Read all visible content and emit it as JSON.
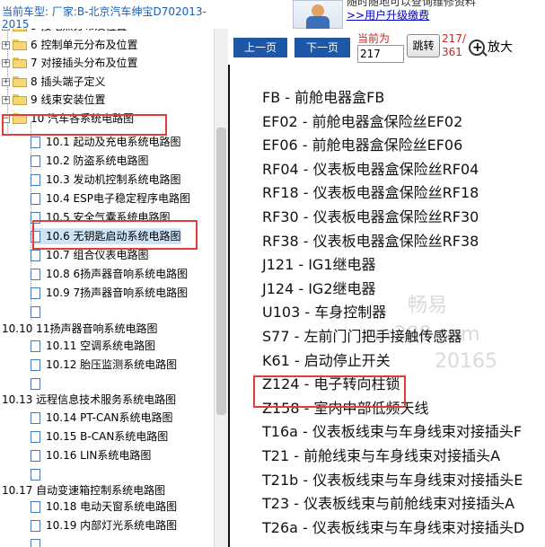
{
  "header": {
    "vehicle_line1": "当前车型: 厂家:B-北京汽车绅宝D702013-",
    "vehicle_line2": "2015",
    "ad_line1": "随时随地可以查询维修资料",
    "ad_link": ">>用户升级缴费"
  },
  "sidebar": {
    "folders_top": [
      {
        "label": "5 接地点分布及位置"
      },
      {
        "label": "6 控制单元分布及位置"
      },
      {
        "label": "7 对接插头分布及位置"
      },
      {
        "label": "8 插头端子定义"
      },
      {
        "label": "9 线束安装位置"
      },
      {
        "label": "10 汽车各系统电路图"
      }
    ],
    "children_a": [
      {
        "label": "10.1 起动及充电系统电路图"
      },
      {
        "label": "10.2 防盗系统电路图"
      },
      {
        "label": "10.3 发动机控制系统电路图"
      },
      {
        "label": "10.4 ESP电子稳定程序电路图"
      },
      {
        "label": "10.5 安全气囊系统电路图"
      },
      {
        "label": "10.6 无钥匙启动系统电路图"
      },
      {
        "label": "10.7 组合仪表电路图"
      },
      {
        "label": "10.8 6扬声器音响系统电路图"
      },
      {
        "label": "10.9 7扬声器音响系统电路图"
      },
      {
        "label": ""
      }
    ],
    "group_1010": "10.10 11扬声器音响系统电路图",
    "children_b": [
      {
        "label": "10.11 空调系统电路图"
      },
      {
        "label": "10.12 胎压监测系统电路图"
      },
      {
        "label": ""
      }
    ],
    "group_1013": "10.13 远程信息技术服务系统电路图",
    "children_c": [
      {
        "label": "10.14 PT-CAN系统电路图"
      },
      {
        "label": "10.15 B-CAN系统电路图"
      },
      {
        "label": "10.16 LIN系统电路图"
      },
      {
        "label": ""
      }
    ],
    "group_1017": "10.17 自动变速箱控制系统电路图",
    "children_d": [
      {
        "label": "10.18 电动天窗系统电路图"
      },
      {
        "label": "10.19 内部灯光系统电路图"
      },
      {
        "label": ""
      }
    ]
  },
  "toolbar": {
    "prev": "上一页",
    "next": "下一页",
    "current_label": "当前为",
    "current_value": "217",
    "jump": "跳转",
    "page_num": "217/",
    "page_total": "361",
    "zoom": "放大"
  },
  "document": {
    "entries": [
      "FB - 前舱电器盒FB",
      "EF02 - 前舱电器盒保险丝EF02",
      "EF06 - 前舱电器盒保险丝EF06",
      "RF04 - 仪表板电器盒保险丝RF04",
      "RF18 - 仪表板电器盒保险丝RF18",
      "RF30 - 仪表板电器盒保险丝RF30",
      "RF38 - 仪表板电器盒保险丝RF38",
      "J121 - IG1继电器",
      "J124 - IG2继电器",
      "U103 - 车身控制器",
      "S77 - 左前门门把手接触传感器",
      "K61 - 启动停止开关",
      "Z124 - 电子转向柱锁",
      "Z158 - 室内中部低频天线",
      "T16a - 仪表板线束与车身线束对接插头F",
      "T21 - 前舱线束与车身线束对接插头A",
      "T21b - 仪表板线束与车身线束对接插头E",
      "T23 - 仪表板线束与前舱线束对接插头A",
      "T26a - 仪表板线束与车身线束对接插头D"
    ],
    "watermark_1": "畅易",
    "watermark_2": "car388.com",
    "watermark_3": "20165"
  },
  "colors": {
    "nav_button": "#1e57a6",
    "highlight": "#e23b3b",
    "link": "#0000cc"
  }
}
